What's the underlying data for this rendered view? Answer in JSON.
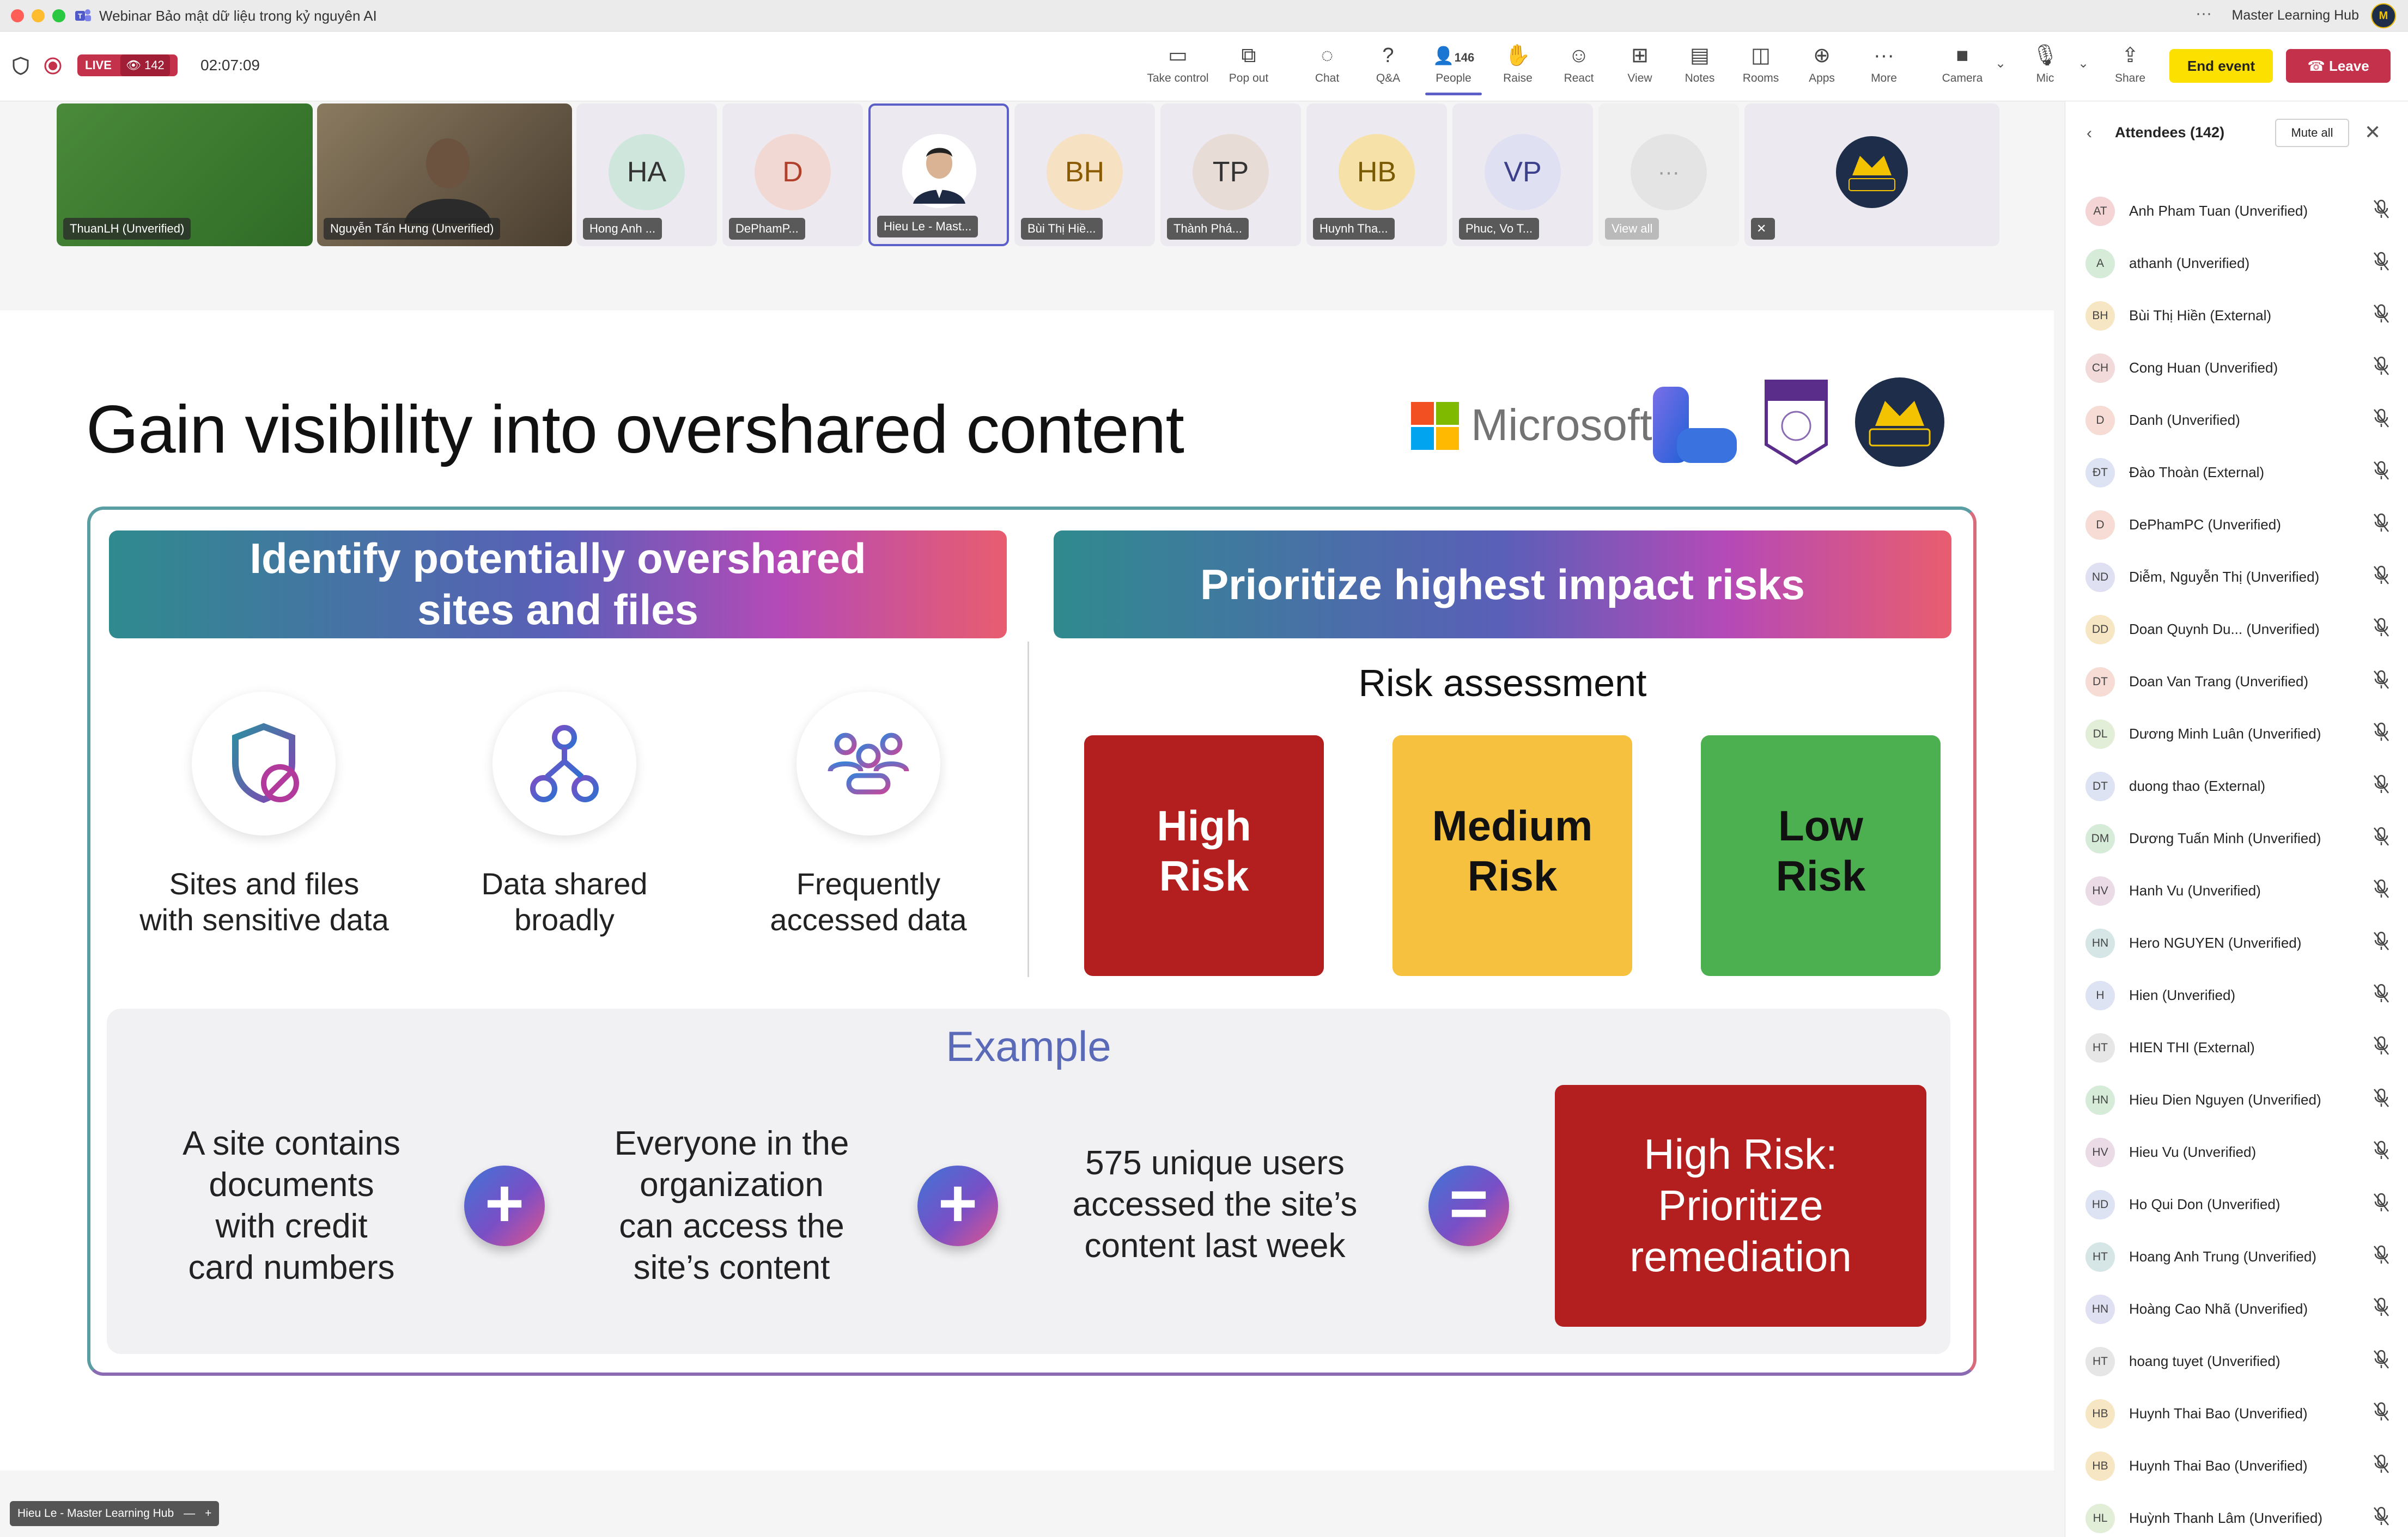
{
  "window": {
    "title": "Webinar Bảo mật dữ liệu trong kỷ nguyên AI",
    "account": "Master Learning Hub",
    "avatar_text": "M"
  },
  "toolbar": {
    "live_label": "LIVE",
    "viewer_count": "142",
    "timer": "02:07:09",
    "buttons": [
      {
        "label": "Take control",
        "icon": "take-control-icon"
      },
      {
        "label": "Pop out",
        "icon": "pop-out-icon"
      },
      {
        "label": "Chat",
        "icon": "chat-icon"
      },
      {
        "label": "Q&A",
        "icon": "qa-icon"
      },
      {
        "label": "People",
        "icon": "people-icon",
        "badge": "146"
      },
      {
        "label": "Raise",
        "icon": "raise-hand-icon"
      },
      {
        "label": "React",
        "icon": "react-icon"
      },
      {
        "label": "View",
        "icon": "view-icon"
      },
      {
        "label": "Notes",
        "icon": "notes-icon"
      },
      {
        "label": "Rooms",
        "icon": "rooms-icon"
      },
      {
        "label": "Apps",
        "icon": "apps-icon"
      },
      {
        "label": "More",
        "icon": "more-icon"
      },
      {
        "label": "Camera",
        "icon": "camera-off-icon"
      },
      {
        "label": "Mic",
        "icon": "mic-off-icon"
      },
      {
        "label": "Share",
        "icon": "share-icon"
      }
    ],
    "end_event": "End event",
    "leave": "Leave"
  },
  "participants": [
    {
      "name": "ThuanLH (Unverified)",
      "initials": ""
    },
    {
      "name": "Nguyễn Tấn Hưng (Unverified)",
      "initials": ""
    },
    {
      "name": "Hong Anh ...",
      "initials": "HA"
    },
    {
      "name": "DePhamP...",
      "initials": "D"
    },
    {
      "name": "Hieu Le - Mast...",
      "initials": ""
    },
    {
      "name": "Bùi Thị Hiề...",
      "initials": "BH"
    },
    {
      "name": "Thành Phá...",
      "initials": "TP"
    },
    {
      "name": "Huynh Tha...",
      "initials": "HB"
    },
    {
      "name": "Phuc, Vo T...",
      "initials": "VP"
    },
    {
      "name": "View all",
      "initials": "···"
    },
    {
      "name": "",
      "initials": ""
    }
  ],
  "slide": {
    "title": "Gain visibility into overshared content",
    "microsoft_text": "Microsoft",
    "left_header": [
      "Identify potentially overshared",
      "sites and files"
    ],
    "right_header": "Prioritize highest impact risks",
    "features": [
      {
        "lines": [
          "Sites and files",
          "with sensitive data"
        ],
        "icon": "shield-block-icon"
      },
      {
        "lines": [
          "Data shared",
          "broadly"
        ],
        "icon": "share-network-icon"
      },
      {
        "lines": [
          "Frequently",
          "accessed data"
        ],
        "icon": "people-group-icon"
      }
    ],
    "risk_assessment_title": "Risk assessment",
    "risks": [
      {
        "lines": [
          "High",
          "Risk"
        ],
        "color": "#b31f1f",
        "text_color": "#ffffff"
      },
      {
        "lines": [
          "Medium",
          "Risk"
        ],
        "color": "#f5c13e",
        "text_color": "#111111"
      },
      {
        "lines": [
          "Low",
          "Risk"
        ],
        "color": "#4caf50",
        "text_color": "#111111"
      }
    ],
    "example_title": "Example",
    "example": [
      [
        "A site contains",
        "documents",
        "with credit",
        "card numbers"
      ],
      [
        "Everyone in the",
        "organization",
        "can access the",
        "site’s content"
      ],
      [
        "575 unique users",
        "accessed the site’s",
        "content last week"
      ]
    ],
    "operators": [
      "+",
      "+",
      "="
    ],
    "result": [
      "High Risk:",
      "Prioritize",
      "remediation"
    ]
  },
  "presenter_label": "Hieu Le - Master Learning Hub",
  "attendees_panel": {
    "title": "Attendees (142)",
    "mute_all": "Mute all",
    "attendees": [
      {
        "initials": "AT",
        "name": "Anh Pham Tuan (Unverified)"
      },
      {
        "initials": "A",
        "name": "athanh (Unverified)"
      },
      {
        "initials": "BH",
        "name": "Bùi Thị Hiền (External)"
      },
      {
        "initials": "CH",
        "name": "Cong Huan (Unverified)"
      },
      {
        "initials": "D",
        "name": "Danh (Unverified)"
      },
      {
        "initials": "ĐT",
        "name": "Đào Thoàn (External)"
      },
      {
        "initials": "D",
        "name": "DePhamPC (Unverified)"
      },
      {
        "initials": "ND",
        "name": "Diễm, Nguyễn Thị (Unverified)"
      },
      {
        "initials": "DD",
        "name": "Doan Quynh Du...   (Unverified)"
      },
      {
        "initials": "DT",
        "name": "Doan Van Trang (Unverified)"
      },
      {
        "initials": "DL",
        "name": "Dương Minh Luân (Unverified)"
      },
      {
        "initials": "DT",
        "name": "duong thao (External)"
      },
      {
        "initials": "DM",
        "name": "Dương Tuấn Minh (Unverified)"
      },
      {
        "initials": "HV",
        "name": "Hanh Vu (Unverified)"
      },
      {
        "initials": "HN",
        "name": "Hero NGUYEN (Unverified)"
      },
      {
        "initials": "H",
        "name": "Hien (Unverified)"
      },
      {
        "initials": "HT",
        "name": "HIEN THI (External)"
      },
      {
        "initials": "HN",
        "name": "Hieu Dien Nguyen (Unverified)"
      },
      {
        "initials": "HV",
        "name": "Hieu Vu (Unverified)"
      },
      {
        "initials": "HD",
        "name": "Ho Qui Don (Unverified)"
      },
      {
        "initials": "HT",
        "name": "Hoang Anh Trung (Unverified)"
      },
      {
        "initials": "HN",
        "name": "Hoàng Cao Nhã (Unverified)"
      },
      {
        "initials": "HT",
        "name": "hoang tuyet (Unverified)"
      },
      {
        "initials": "HB",
        "name": "Huynh Thai Bao (Unverified)"
      },
      {
        "initials": "HB",
        "name": "Huynh Thai Bao (Unverified)"
      },
      {
        "initials": "HL",
        "name": "Huỳnh Thanh Lâm (Unverified)"
      }
    ]
  }
}
